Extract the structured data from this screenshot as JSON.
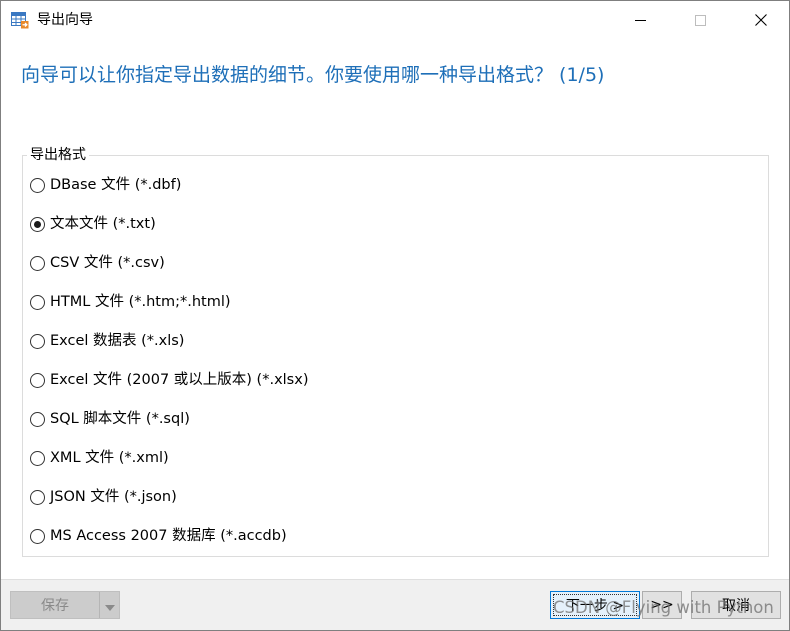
{
  "window": {
    "title": "导出向导",
    "icon": "table-export-icon",
    "controls": {
      "minimize": "minimize-icon",
      "maximize": "maximize-icon",
      "close": "close-icon"
    }
  },
  "heading": "向导可以让你指定导出数据的细节。你要使用哪一种导出格式？ (1/5)",
  "format_group": {
    "label": "导出格式",
    "selected_index": 1,
    "options": [
      {
        "label": "DBase 文件 (*.dbf)",
        "checked": false
      },
      {
        "label": "文本文件 (*.txt)",
        "checked": true
      },
      {
        "label": "CSV 文件 (*.csv)",
        "checked": false
      },
      {
        "label": "HTML 文件 (*.htm;*.html)",
        "checked": false
      },
      {
        "label": "Excel 数据表 (*.xls)",
        "checked": false
      },
      {
        "label": "Excel 文件 (2007 或以上版本) (*.xlsx)",
        "checked": false
      },
      {
        "label": "SQL 脚本文件 (*.sql)",
        "checked": false
      },
      {
        "label": "XML 文件 (*.xml)",
        "checked": false
      },
      {
        "label": "JSON 文件 (*.json)",
        "checked": false
      },
      {
        "label": "MS Access 2007 数据库 (*.accdb)",
        "checked": false
      }
    ]
  },
  "footer": {
    "save_label": "保存",
    "next_label": "下一步 >",
    "last_label": ">>",
    "cancel_label": "取消",
    "watermark": "CSDN @Flying with Python"
  },
  "colors": {
    "heading": "#1e6fb8",
    "accent": "#0078d7",
    "footer_bg": "#f0f0f0"
  }
}
